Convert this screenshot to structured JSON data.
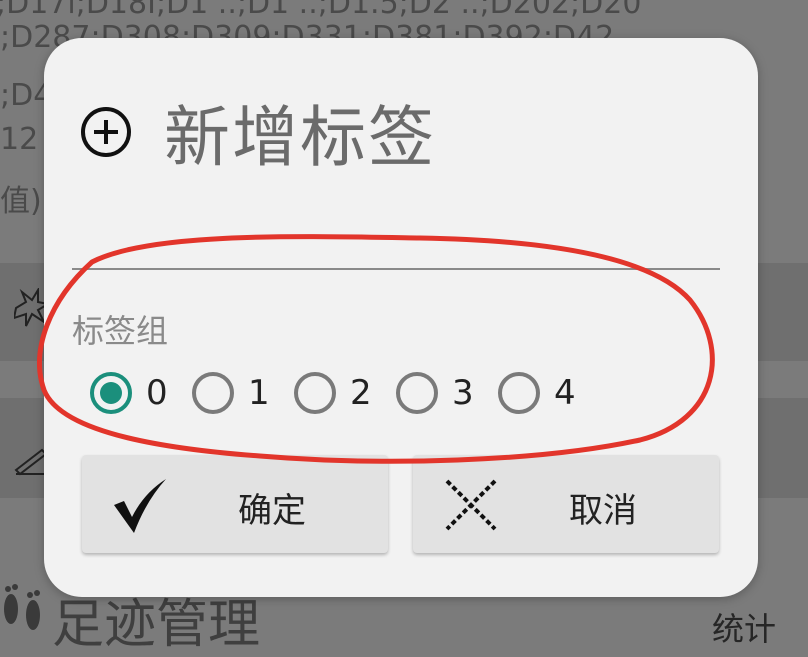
{
  "background": {
    "text_lines": [
      ";D287;D308;D309;D331;D381;D392;D42",
      ";D4",
      "12",
      "值)"
    ],
    "footer_title": "足迹管理",
    "footer_stat": "统计"
  },
  "dialog": {
    "icon": "plus-circle-icon",
    "title": "新增标签",
    "name_input": {
      "value": "",
      "placeholder": ""
    },
    "group_label": "标签组",
    "groups": [
      {
        "label": "0",
        "selected": true
      },
      {
        "label": "1",
        "selected": false
      },
      {
        "label": "2",
        "selected": false
      },
      {
        "label": "3",
        "selected": false
      },
      {
        "label": "4",
        "selected": false
      }
    ],
    "ok_button": {
      "label": "确定",
      "icon": "check-icon"
    },
    "cancel_button": {
      "label": "取消",
      "icon": "cross-icon"
    }
  },
  "colors": {
    "accent": "#1b8f7c",
    "annotation": "#e2352b",
    "dialog_bg": "#f2f2f2",
    "button_bg": "#e2e2e2"
  }
}
